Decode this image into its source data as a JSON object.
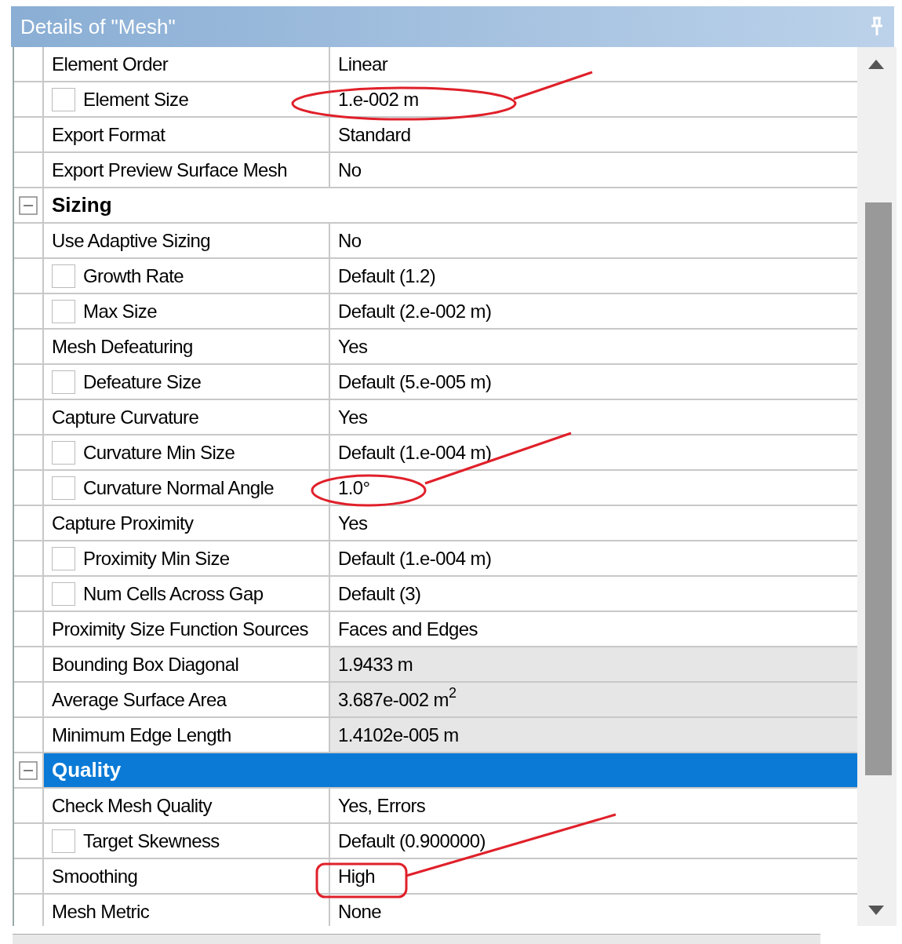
{
  "title": "Details of \"Mesh\"",
  "rows": [
    {
      "kind": "property",
      "label": "Element Order",
      "value": "Linear"
    },
    {
      "kind": "property",
      "label": "Element Size",
      "value": "1.e-002 m",
      "checked": false
    },
    {
      "kind": "property",
      "label": "Export Format",
      "value": "Standard"
    },
    {
      "kind": "property",
      "label": "Export Preview Surface Mesh",
      "value": "No"
    },
    {
      "kind": "group",
      "label": "Sizing",
      "expanded": true,
      "selected": false
    },
    {
      "kind": "property",
      "label": "Use Adaptive Sizing",
      "value": "No"
    },
    {
      "kind": "property",
      "label": "Growth Rate",
      "value": "Default (1.2)",
      "checked": false
    },
    {
      "kind": "property",
      "label": "Max Size",
      "value": "Default (2.e-002 m)",
      "checked": false
    },
    {
      "kind": "property",
      "label": "Mesh Defeaturing",
      "value": "Yes"
    },
    {
      "kind": "property",
      "label": "Defeature Size",
      "value": "Default (5.e-005 m)",
      "checked": false
    },
    {
      "kind": "property",
      "label": "Capture Curvature",
      "value": "Yes"
    },
    {
      "kind": "property",
      "label": "Curvature Min Size",
      "value": "Default (1.e-004 m)",
      "checked": false
    },
    {
      "kind": "property",
      "label": "Curvature Normal Angle",
      "value": "1.0°",
      "checked": false
    },
    {
      "kind": "property",
      "label": "Capture Proximity",
      "value": "Yes"
    },
    {
      "kind": "property",
      "label": "Proximity Min Size",
      "value": "Default (1.e-004 m)",
      "checked": false
    },
    {
      "kind": "property",
      "label": "Num Cells Across Gap",
      "value": "Default (3)",
      "checked": false
    },
    {
      "kind": "property",
      "label": "Proximity Size Function Sources",
      "value": "Faces and Edges"
    },
    {
      "kind": "readonly",
      "label": "Bounding Box Diagonal",
      "value": "1.9433 m"
    },
    {
      "kind": "readonly",
      "label": "Average Surface Area",
      "value": "3.687e-002 m$^{2}$"
    },
    {
      "kind": "readonly",
      "label": "Minimum Edge Length",
      "value": "1.4102e-005 m"
    },
    {
      "kind": "group",
      "label": "Quality",
      "expanded": true,
      "selected": true
    },
    {
      "kind": "property",
      "label": "Check Mesh Quality",
      "value": "Yes, Errors"
    },
    {
      "kind": "property",
      "label": "Target Skewness",
      "value": "Default (0.900000)",
      "checked": false
    },
    {
      "kind": "property",
      "label": "Smoothing",
      "value": "High"
    },
    {
      "kind": "property",
      "label": "Mesh Metric",
      "value": "None"
    }
  ]
}
